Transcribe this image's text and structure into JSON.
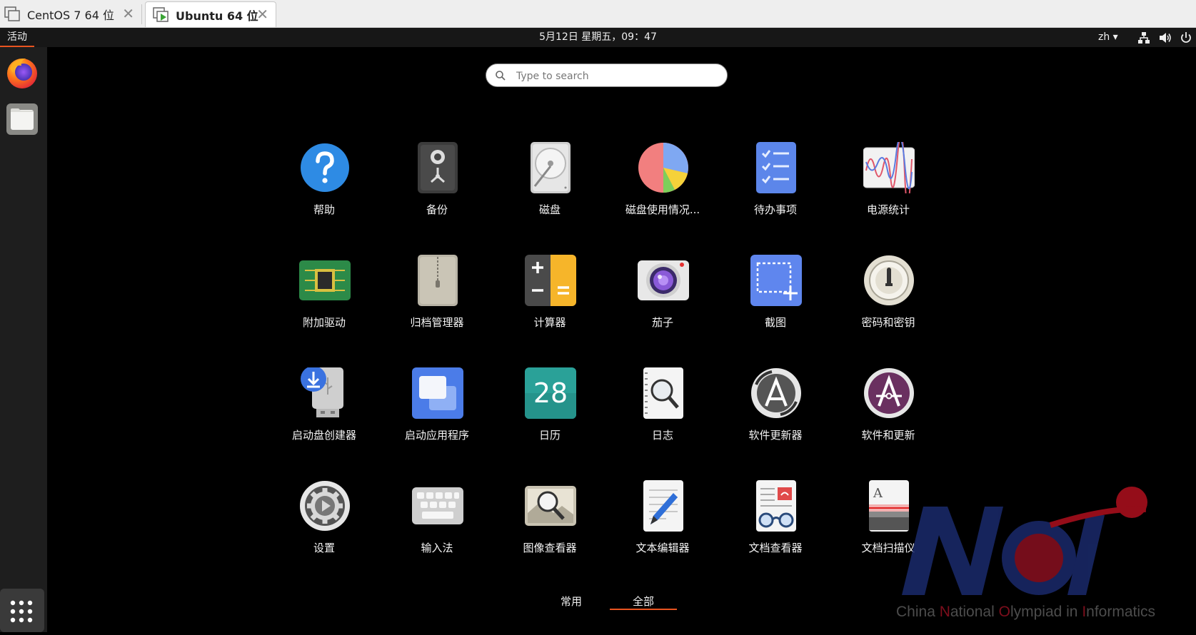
{
  "vm_tabs": [
    {
      "label": "CentOS 7 64 位",
      "active": false
    },
    {
      "label": "Ubuntu 64 位",
      "active": true
    }
  ],
  "topbar": {
    "activities": "活动",
    "clock": "5月12日 星期五，09：47",
    "lang": "zh ▾",
    "tray_icons": [
      "network-icon",
      "volume-icon",
      "power-icon"
    ]
  },
  "dock": {
    "items": [
      "firefox-icon",
      "files-icon"
    ],
    "show_apps": "show-apps-icon"
  },
  "search": {
    "placeholder": "Type to search",
    "value": ""
  },
  "apps": [
    {
      "label": "帮助",
      "icon": "help-icon"
    },
    {
      "label": "备份",
      "icon": "backup-icon"
    },
    {
      "label": "磁盘",
      "icon": "disks-icon"
    },
    {
      "label": "磁盘使用情况...",
      "icon": "disk-usage-icon"
    },
    {
      "label": "待办事项",
      "icon": "todo-icon"
    },
    {
      "label": "电源统计",
      "icon": "power-statistics-icon"
    },
    {
      "label": "附加驱动",
      "icon": "additional-drivers-icon"
    },
    {
      "label": "归档管理器",
      "icon": "archive-manager-icon"
    },
    {
      "label": "计算器",
      "icon": "calculator-icon"
    },
    {
      "label": "茄子",
      "icon": "cheese-icon"
    },
    {
      "label": "截图",
      "icon": "screenshot-icon"
    },
    {
      "label": "密码和密钥",
      "icon": "passwords-keys-icon"
    },
    {
      "label": "启动盘创建器",
      "icon": "startup-disk-creator-icon"
    },
    {
      "label": "启动应用程序",
      "icon": "startup-applications-icon"
    },
    {
      "label": "日历",
      "icon": "calendar-icon",
      "text": "28"
    },
    {
      "label": "日志",
      "icon": "logs-icon"
    },
    {
      "label": "软件更新器",
      "icon": "software-updater-icon"
    },
    {
      "label": "软件和更新",
      "icon": "software-updates-icon"
    },
    {
      "label": "设置",
      "icon": "settings-icon"
    },
    {
      "label": "输入法",
      "icon": "input-method-icon"
    },
    {
      "label": "图像查看器",
      "icon": "image-viewer-icon"
    },
    {
      "label": "文本编辑器",
      "icon": "text-editor-icon"
    },
    {
      "label": "文档查看器",
      "icon": "document-viewer-icon"
    },
    {
      "label": "文档扫描仪",
      "icon": "document-scanner-icon"
    }
  ],
  "categories": [
    {
      "label": "常用",
      "active": false
    },
    {
      "label": "全部",
      "active": true
    }
  ],
  "watermark": {
    "text": "China National Olympiad in Informatics",
    "highlight_color": "#c8102e",
    "logo_color": "#1a2a6c"
  }
}
